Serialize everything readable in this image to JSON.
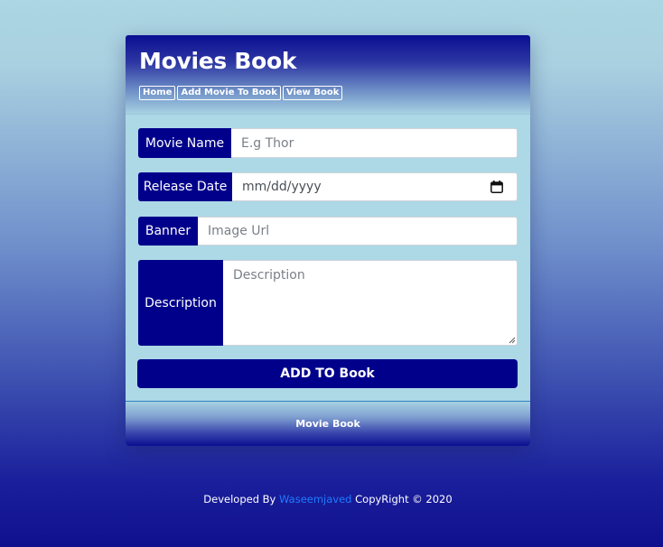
{
  "header": {
    "title": "Movies Book",
    "nav": [
      "Home",
      "Add Movie To Book",
      "View Book"
    ]
  },
  "form": {
    "movie_name": {
      "label": "Movie Name",
      "placeholder": "E.g Thor"
    },
    "release_date": {
      "label": "Release Date",
      "value": "mm/dd/yyyy",
      "icon": "calendar-icon"
    },
    "banner": {
      "label": "Banner",
      "placeholder": "Image Url"
    },
    "description": {
      "label": "Description",
      "placeholder": "Description"
    },
    "submit_label": "ADD TO Book"
  },
  "footer": {
    "title": "Movie Book"
  },
  "credit": {
    "prefix": "Developed By",
    "author": "Waseemjaved",
    "suffix": "CopyRight © 2020"
  },
  "colors": {
    "accent": "#00008b",
    "link": "#1e7bff",
    "card": "#add8e6"
  }
}
